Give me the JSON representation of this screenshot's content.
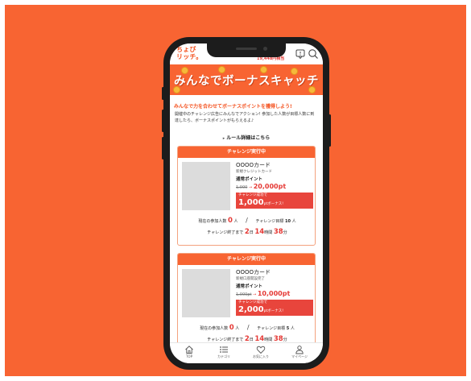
{
  "app": {
    "logo_line1": "ちょび",
    "logo_line2": "リッチ。",
    "points": "19,448円相当"
  },
  "banner": {
    "title": "みんなでボーナスキャッチ"
  },
  "intro": {
    "headline": "みんなで力を合わせてボーナスポイントを獲得しよう!",
    "body": "開催中のチャレンジ広告にみんなでアクション! 参加した人数が目標人数に到達したら、ボーナスポイントがもらえるよ♪",
    "rule_link": "ルール詳細はこちら"
  },
  "cards": [
    {
      "status": "チャレンジ実行中",
      "name": "OOOOカード",
      "subtitle": "新規クレジットカード",
      "point_label": "通常ポイント",
      "point_old": "1,000",
      "point_arrow": "→",
      "point_new": "20,000pt",
      "bonus_label": "チャレンジ成功で",
      "bonus_value": "1,000",
      "bonus_unit": "ptボーナス!",
      "participants_label": "現在の参加人数",
      "participants_value": "0",
      "participants_unit": "人",
      "goal_label": "チャレンジ目標",
      "goal_value": "10",
      "goal_unit": "人",
      "deadline_label": "チャレンジ終了まで",
      "days": "2",
      "days_unit": "日",
      "hours": "14",
      "hours_unit": "時間",
      "minutes": "38",
      "minutes_unit": "分"
    },
    {
      "status": "チャレンジ実行中",
      "name": "OOOOカード",
      "subtitle": "新規口座開設完了",
      "point_label": "通常ポイント",
      "point_old": "1,000pt",
      "point_arrow": "→",
      "point_new": "10,000pt",
      "bonus_label": "チャレンジ成功で",
      "bonus_value": "2,000",
      "bonus_unit": "ptボーナス!",
      "participants_label": "現在の参加人数",
      "participants_value": "0",
      "participants_unit": "人",
      "goal_label": "チャレンジ目標",
      "goal_value": "5",
      "goal_unit": "人",
      "deadline_label": "チャレンジ終了まで",
      "days": "2",
      "days_unit": "日",
      "hours": "14",
      "hours_unit": "時間",
      "minutes": "38",
      "minutes_unit": "分"
    }
  ],
  "tabbar": {
    "items": [
      {
        "label": "TOP",
        "icon": "home-icon"
      },
      {
        "label": "カテゴリ",
        "icon": "list-icon"
      },
      {
        "label": "お気に入り",
        "icon": "heart-icon"
      },
      {
        "label": "マイページ",
        "icon": "person-icon"
      }
    ]
  },
  "colors": {
    "background": "#F86432",
    "accent": "#F4511E",
    "highlight": "#E53935",
    "coin": "#F6B93B"
  }
}
